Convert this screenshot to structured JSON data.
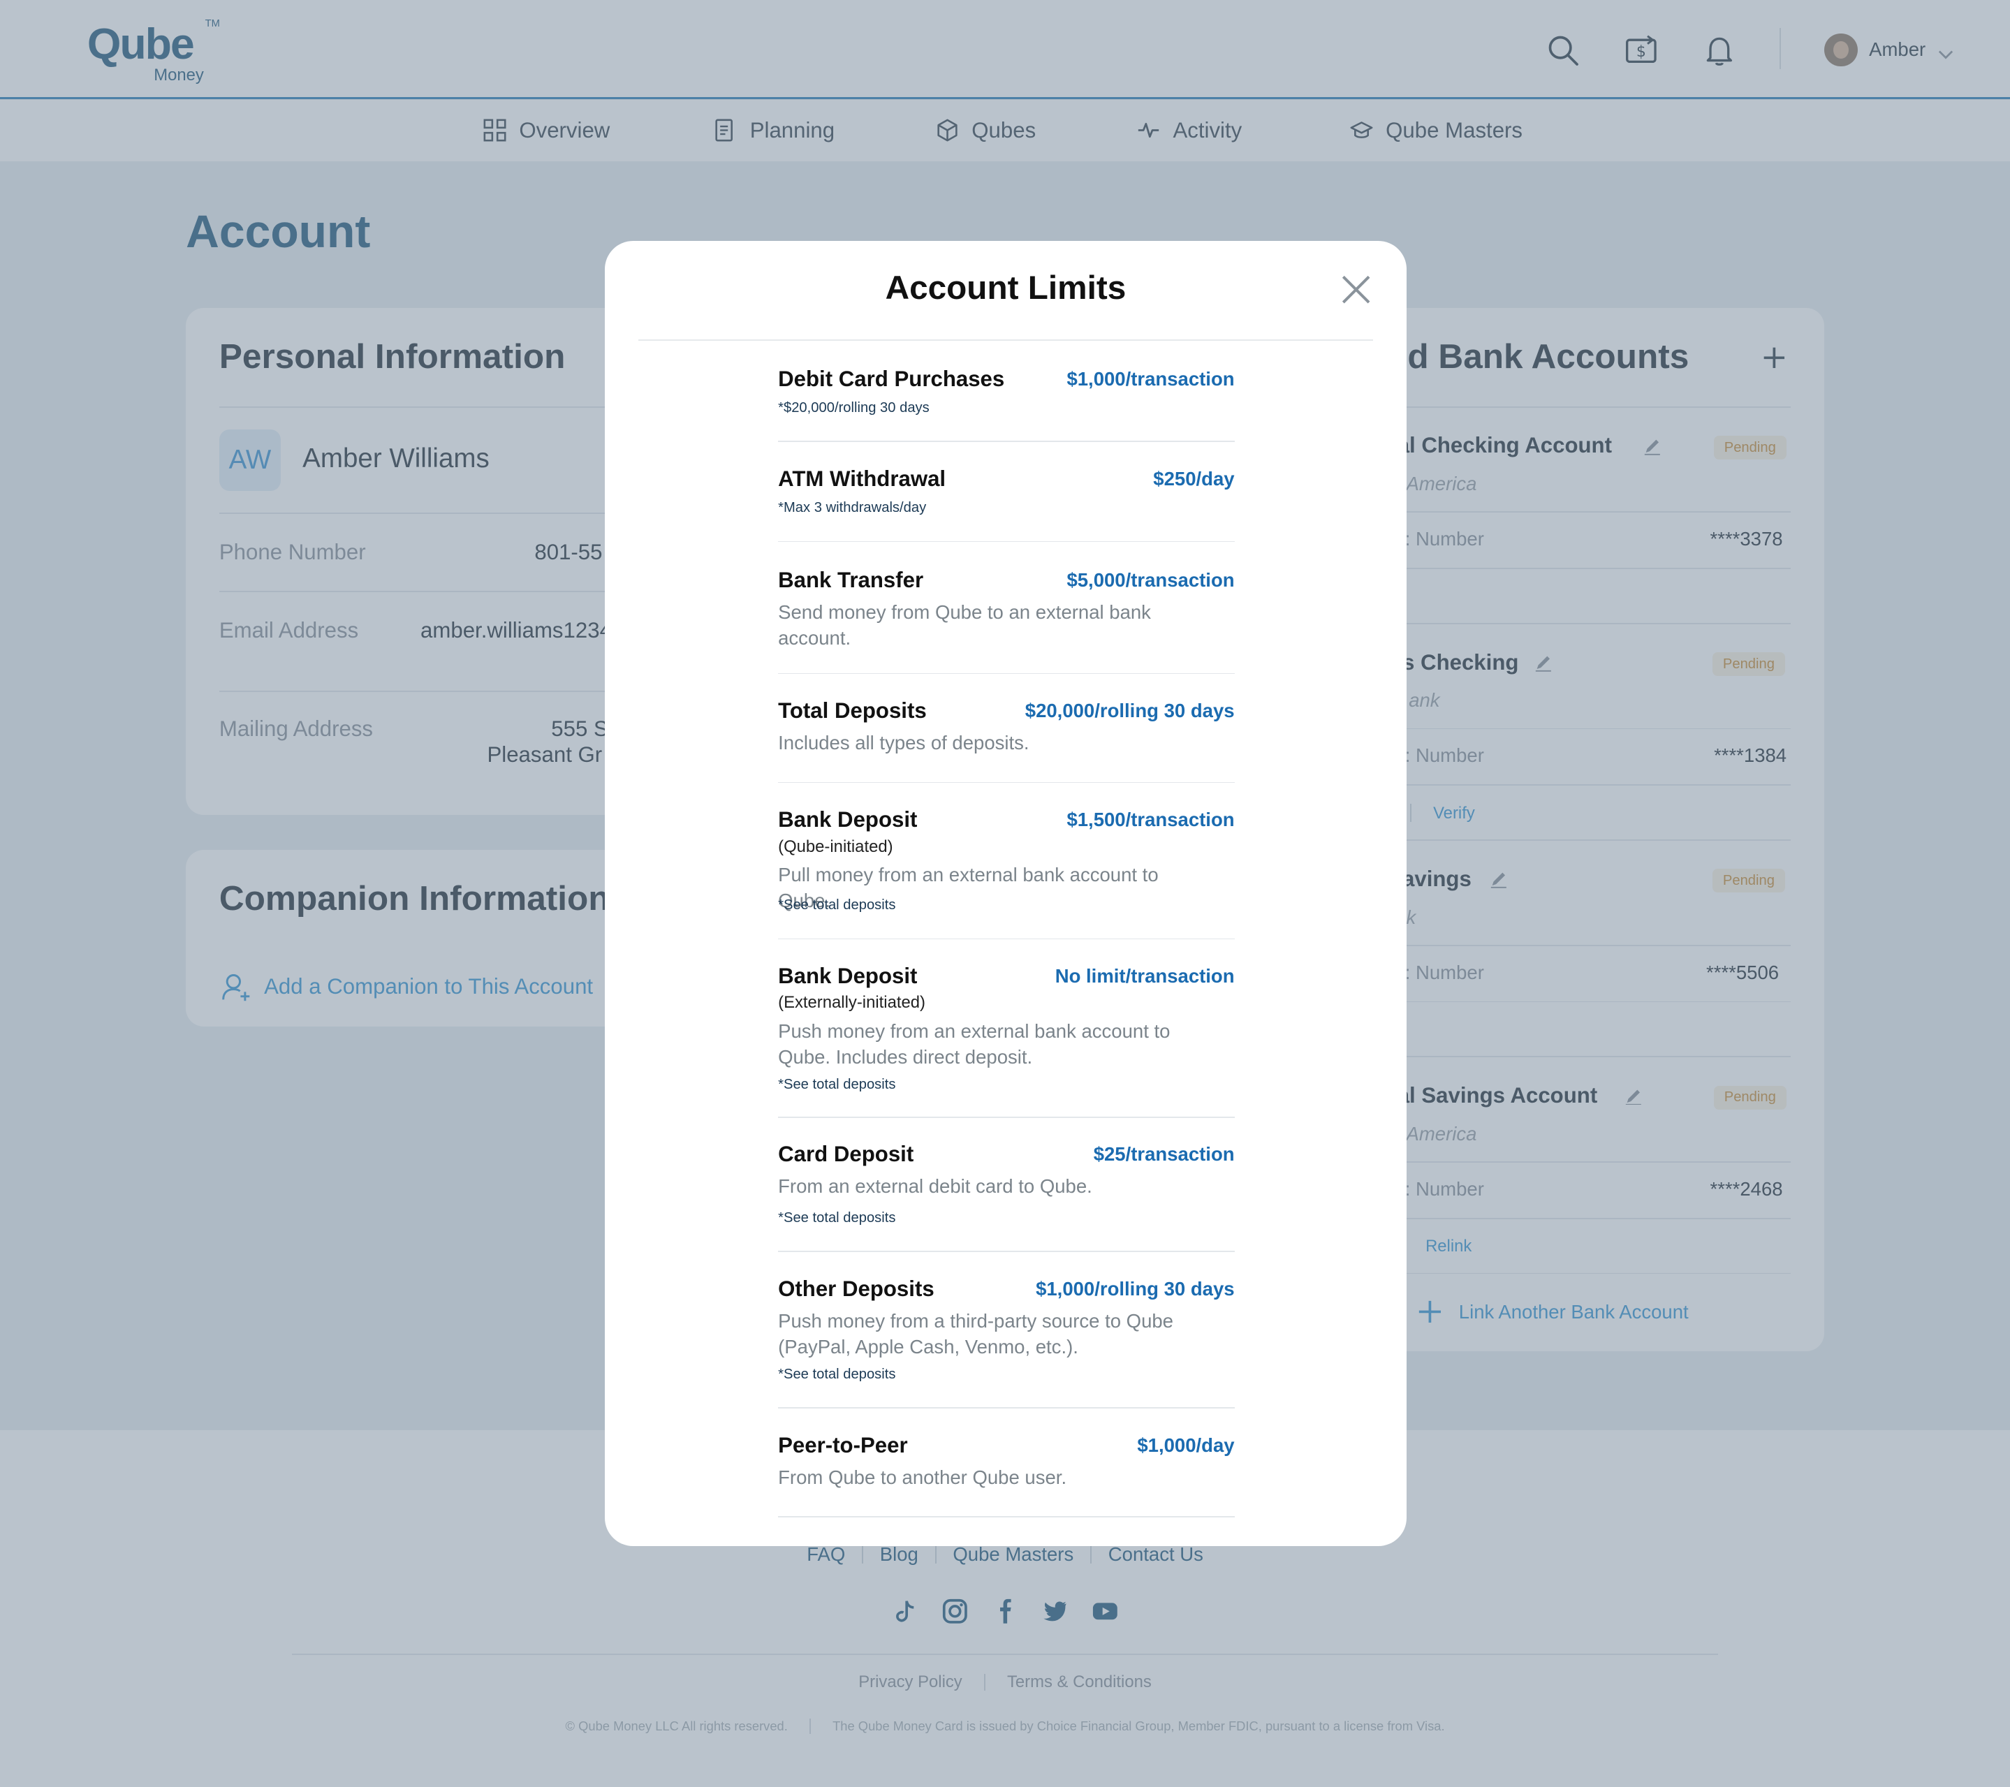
{
  "header": {
    "logo_text": "Qube",
    "logo_sub": "Money",
    "logo_tm": "TM",
    "user_name": "Amber",
    "icons": [
      "search-icon",
      "money-transfer-icon",
      "bell-icon",
      "chevron-down-icon"
    ]
  },
  "nav": {
    "items": [
      {
        "label": "Overview",
        "icon": "grid-icon"
      },
      {
        "label": "Planning",
        "icon": "document-icon"
      },
      {
        "label": "Qubes",
        "icon": "cube-icon"
      },
      {
        "label": "Activity",
        "icon": "pulse-icon"
      },
      {
        "label": "Qube Masters",
        "icon": "graduation-cap-icon"
      }
    ]
  },
  "page": {
    "title": "Account"
  },
  "personal": {
    "title": "Personal Information",
    "initials": "AW",
    "full_name": "Amber Williams",
    "phone_label": "Phone Number",
    "phone_value": "801-55",
    "email_label": "Email Address",
    "email_value": "amber.williams1234",
    "mail_label": "Mailing Address",
    "mail_line1": "555 S",
    "mail_line2": "Pleasant Gr"
  },
  "companion": {
    "title": "Companion Information",
    "add_label": "Add a Companion to This Account"
  },
  "bank_accounts": {
    "title": "ed Bank Accounts",
    "link_label": "Link Another Bank Account",
    "accounts": [
      {
        "name": "al Checking Account",
        "bank": "America",
        "status": "Pending",
        "number_label": ": Number",
        "number": "****3378",
        "action": ""
      },
      {
        "name": "s Checking",
        "bank": "ank",
        "status": "Pending",
        "number_label": ": Number",
        "number": "****1384",
        "action": "Verify"
      },
      {
        "name": "avings",
        "bank": "k",
        "status": "Pending",
        "number_label": ": Number",
        "number": "****5506",
        "action": ""
      },
      {
        "name": "al Savings Account",
        "bank": "America",
        "status": "Pending",
        "number_label": ": Number",
        "number": "****2468",
        "action": "Relink"
      }
    ]
  },
  "footer": {
    "links": [
      "FAQ",
      "Blog",
      "Qube Masters",
      "Contact Us"
    ],
    "social": [
      "tiktok-icon",
      "instagram-icon",
      "facebook-icon",
      "twitter-icon",
      "youtube-icon"
    ],
    "legal": [
      "Privacy Policy",
      "Terms & Conditions"
    ],
    "copyright": "© Qube Money LLC All rights reserved.",
    "disclaimer": "The Qube Money Card is issued by Choice Financial Group, Member FDIC, pursuant to a license from Visa."
  },
  "modal": {
    "title": "Account Limits",
    "limits": [
      {
        "title": "Debit Card Purchases",
        "value": "$1,000/transaction",
        "sub": "",
        "desc": "",
        "note": "*$20,000/rolling 30 days"
      },
      {
        "title": "ATM Withdrawal",
        "value": "$250/day",
        "sub": "",
        "desc": "",
        "note": "*Max 3 withdrawals/day"
      },
      {
        "title": "Bank Transfer",
        "value": "$5,000/transaction",
        "sub": "",
        "desc": "Send money from Qube to an external bank account.",
        "note": ""
      },
      {
        "title": "Total Deposits",
        "value": "$20,000/rolling 30 days",
        "sub": "",
        "desc": "Includes all types of deposits.",
        "note": ""
      },
      {
        "title": "Bank Deposit",
        "value": "$1,500/transaction",
        "sub": "(Qube-initiated)",
        "desc": "Pull money from an external bank account to Qube.",
        "note": "*See total deposits"
      },
      {
        "title": "Bank Deposit",
        "value": "No limit/transaction",
        "sub": "(Externally-initiated)",
        "desc": "Push money from an external bank account to Qube. Includes direct deposit.",
        "note": "*See total deposits"
      },
      {
        "title": "Card Deposit",
        "value": "$25/transaction",
        "sub": "",
        "desc": "From an external debit card to Qube.",
        "note": "*See total deposits"
      },
      {
        "title": "Other Deposits",
        "value": "$1,000/rolling 30 days",
        "sub": "",
        "desc": "Push money from a third-party source to Qube (PayPal, Apple Cash, Venmo, etc.).",
        "note": "*See total deposits"
      },
      {
        "title": "Peer-to-Peer",
        "value": "$1,000/day",
        "sub": "",
        "desc": "From Qube to another Qube user.",
        "note": ""
      }
    ]
  },
  "colors": {
    "brand": "#2a5f80",
    "accent": "#3b97d3",
    "limit_value": "#1b6bb0",
    "pending": "#c98f3a",
    "logo_green": "#3bb98a"
  }
}
